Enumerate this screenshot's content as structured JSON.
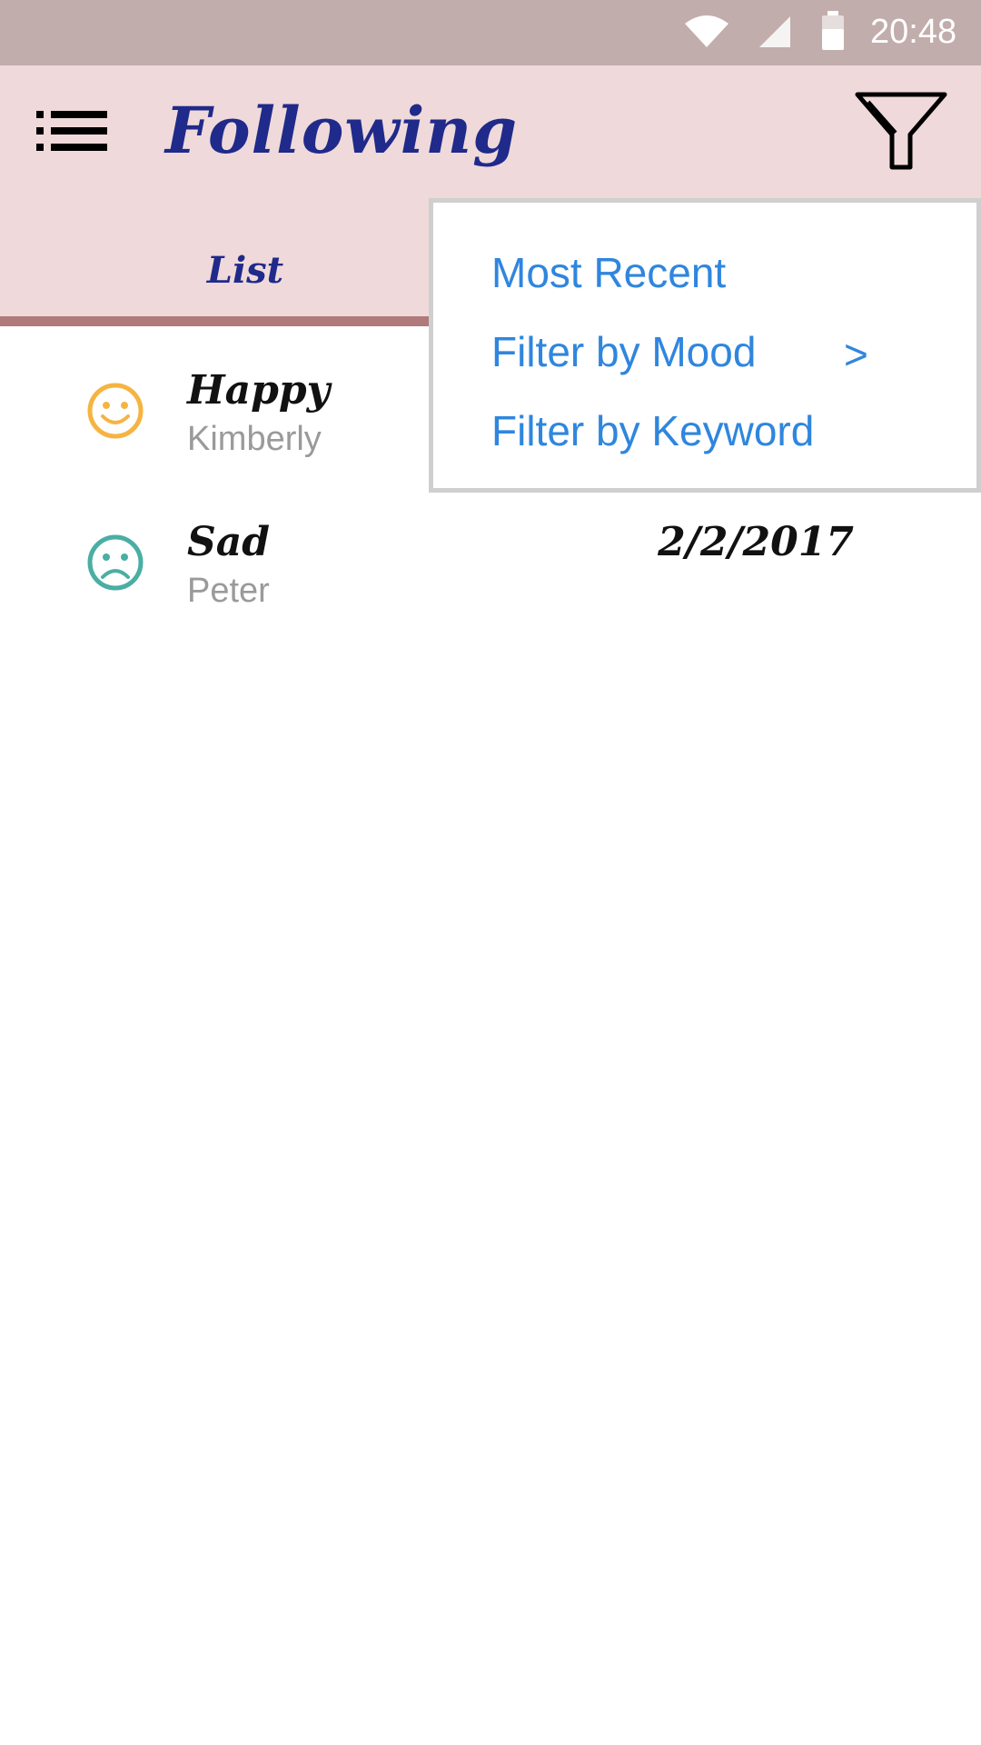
{
  "status_bar": {
    "time": "20:48",
    "wifi_icon": "wifi-icon",
    "signal_icon": "signal-icon",
    "battery_icon": "battery-icon"
  },
  "app_bar": {
    "title": "Following",
    "menu_icon": "list-menu-icon",
    "filter_icon": "funnel-filter-icon",
    "background": "#efd9da",
    "title_color": "#1f2a8a"
  },
  "tabs": [
    {
      "label": "List",
      "selected": true
    }
  ],
  "feed": [
    {
      "mood": "Happy",
      "user": "Kimberly",
      "date": "",
      "icon": "happy-face-icon",
      "icon_color": "#f5b442"
    },
    {
      "mood": "Sad",
      "user": "Peter",
      "date": "2/2/2017",
      "icon": "sad-face-icon",
      "icon_color": "#4aaea3"
    }
  ],
  "filter_menu": {
    "items": [
      {
        "label": "Most Recent"
      },
      {
        "label": "Filter by Mood",
        "submenu_indicator": ">"
      },
      {
        "label": "Filter by Keyword"
      }
    ],
    "text_color": "#2f86de"
  }
}
